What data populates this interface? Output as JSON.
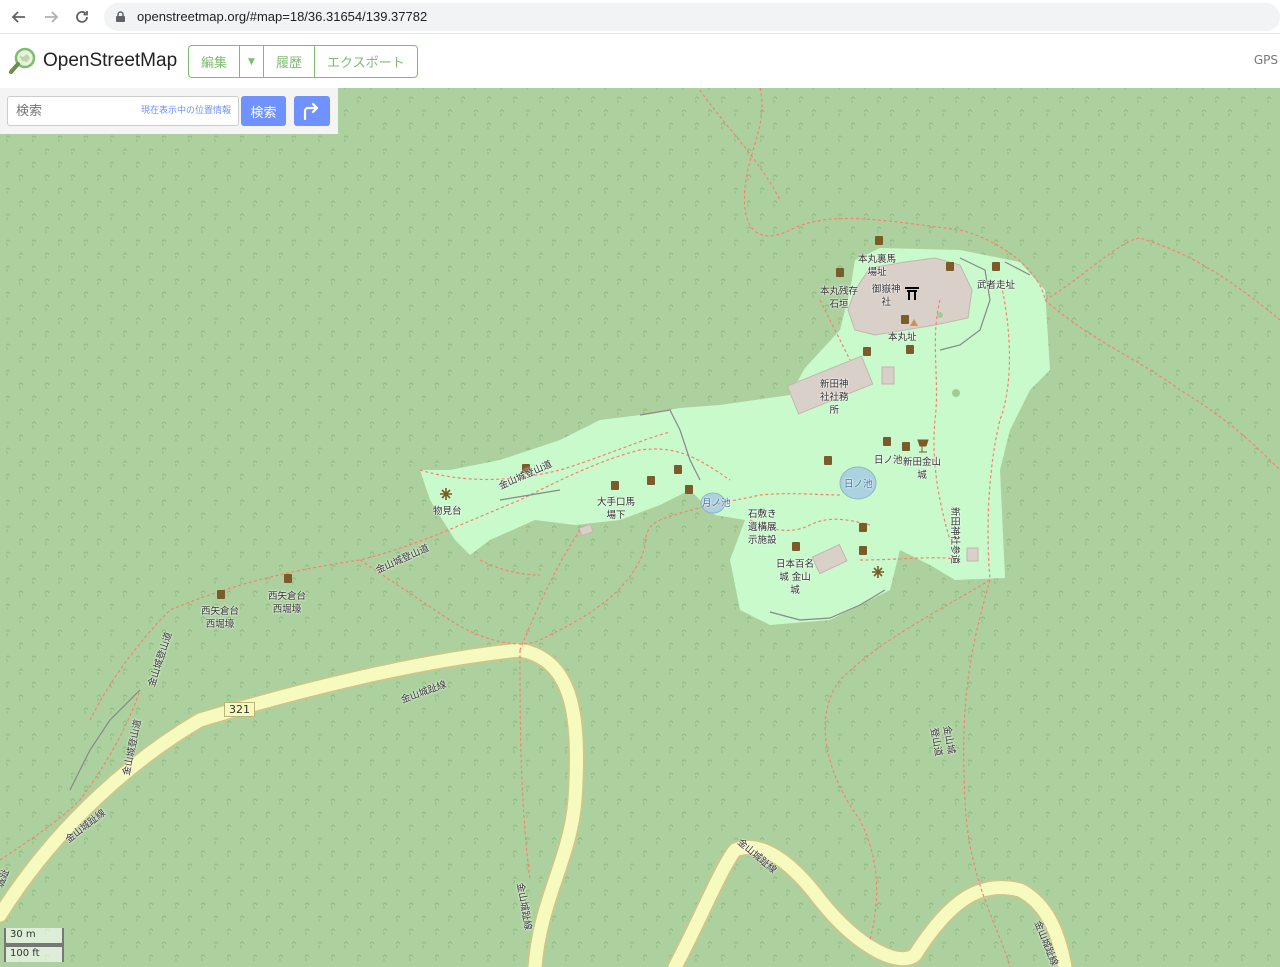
{
  "browser": {
    "url": "openstreetmap.org/#map=18/36.31654/139.37782"
  },
  "header": {
    "logo_text": "OpenStreetMap",
    "edit_label": "編集",
    "history_label": "履歴",
    "export_label": "エクスポート",
    "gps_label": "GPS"
  },
  "search": {
    "placeholder": "検索",
    "where_am_i": "現在表示中の位置情報",
    "button_label": "検索"
  },
  "scale": {
    "metric": "30 m",
    "imperial": "100 ft"
  },
  "map": {
    "road_ref": "321",
    "labels": {
      "honmaru_urababa": "本丸裏馬\n場址",
      "honmaru_zanson": "本丸残存\n石垣",
      "gokei_jinja": "御嶽神\n社",
      "musha_bashiri": "武者走址",
      "honmaru_ato": "本丸址",
      "nitta_shamusho": "新田神\n社社務\n所",
      "hinoike": "日ノ池",
      "hinoike_pond": "日ノ池",
      "nitta_kanayama": "新田金山\n城",
      "tsukinoike": "月ノ池",
      "ishijiki": "石敷き\n遺構展\n示施設",
      "nihon100": "日本百名\n城 金山\n城",
      "otemon": "大手口馬\n場下",
      "monomidai": "物見台",
      "tozando_upper": "金山城登山道",
      "tozando_mid": "金山城登山道",
      "nishiyaguradai": "西矢倉台\n西堀壕",
      "nishiyagura": "西矢倉台\n西堀壕",
      "tozando_left": "金山城登山道",
      "tozando_left2": "金山城登山道",
      "road_main1": "金山城趾線",
      "road_main2": "金山城趾線",
      "road_main3": "金山城趾線",
      "road_main4": "金山城趾線",
      "road_main5": "金山城趾線",
      "sando": "新田神社参道",
      "right_trail": "金山城\n登山道",
      "edge_left": "城趾"
    }
  },
  "colors": {
    "forest": "#add19e",
    "park": "#c8facc",
    "road_fill": "#f7fabf",
    "road_casing": "#c9c78c",
    "path": "#fa8072",
    "building": "#d9d0c9",
    "accent": "#7ebc6f",
    "search_blue": "#7092ff",
    "water": "#aad3df"
  }
}
